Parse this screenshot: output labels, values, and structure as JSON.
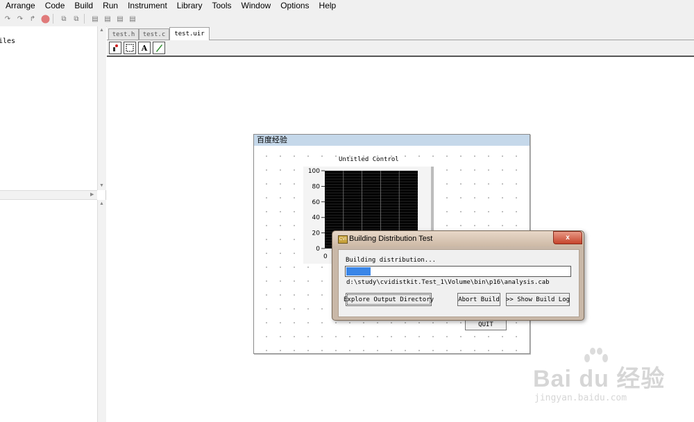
{
  "menubar": {
    "items": [
      "Arrange",
      "Code",
      "Build",
      "Run",
      "Instrument",
      "Library",
      "Tools",
      "Window",
      "Options",
      "Help"
    ]
  },
  "left_pane": {
    "tree_text": "iles"
  },
  "tabs": [
    {
      "label": "test.h",
      "active": false
    },
    {
      "label": "test.c",
      "active": false
    },
    {
      "label": "test.uir",
      "active": true
    }
  ],
  "panel": {
    "title": "百度经验",
    "graph": {
      "title": "Untitled Control",
      "y_ticks": [
        "100",
        "80",
        "60",
        "40",
        "20",
        "0"
      ],
      "x_tick": "0",
      "ymin": 0,
      "ymax": 100
    },
    "quit_label": "QUIT"
  },
  "dialog": {
    "title": "Building Distribution Test",
    "close_label": "x",
    "status": "Building distribution...",
    "progress": 0.11,
    "progress_color": "#3a86e8",
    "path": "d:\\study\\cvidistkit.Test_1\\Volume\\bin\\p16\\analysis.cab",
    "buttons": {
      "explore": "Explore Output Directory",
      "abort": "Abort Build",
      "show_log": ">> Show Build Log"
    }
  },
  "watermark": {
    "logo": "Bai du 经验",
    "url": "jingyan.baidu.com"
  }
}
